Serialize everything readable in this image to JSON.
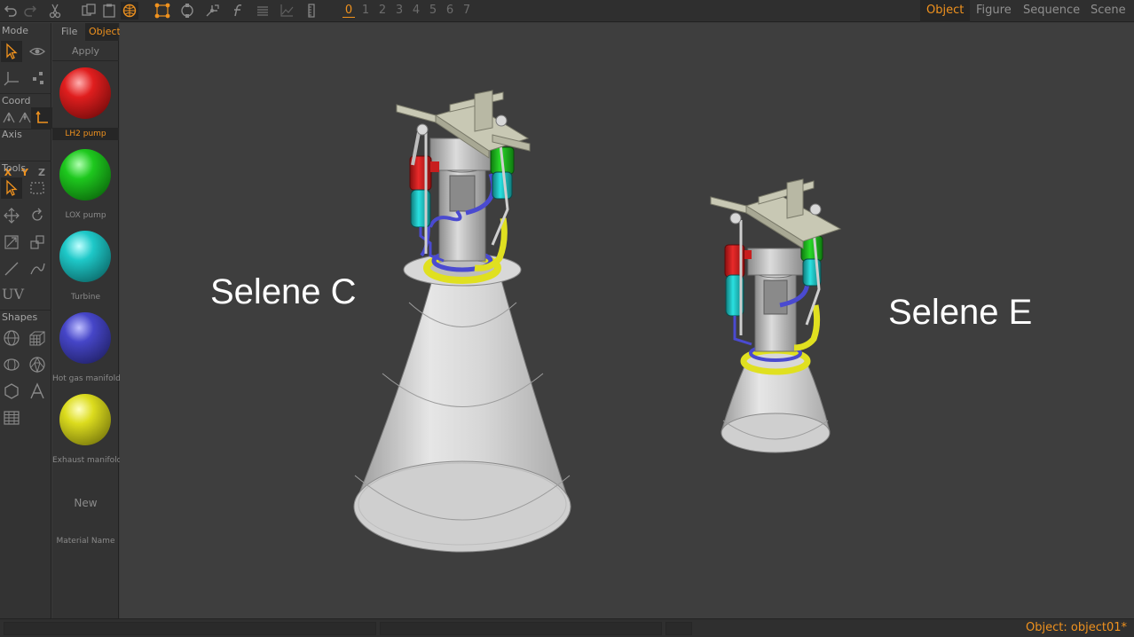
{
  "toolbar": {
    "icons": [
      "undo-icon",
      "redo-icon",
      "cut-icon",
      "copy-icon",
      "paste-icon",
      "select-mode-icon",
      "vertex-icon",
      "rotate-view-icon",
      "transform-icon",
      "function-icon",
      "list-icon",
      "graph-icon",
      "ruler-icon"
    ],
    "layers": [
      "0",
      "1",
      "2",
      "3",
      "4",
      "5",
      "6",
      "7"
    ],
    "active_layer": "0",
    "mode_tabs": [
      "Object",
      "Figure",
      "Sequence",
      "Scene"
    ],
    "active_mode": "Object"
  },
  "left_panel": {
    "mode_label": "Mode",
    "coord_label": "Coord",
    "axis_label": "Axis",
    "axis_x": "X",
    "axis_y": "Y",
    "axis_z": "Z",
    "tools_label": "Tools",
    "uv_label": "UV",
    "shapes_label": "Shapes",
    "accent_color": "#f0921e"
  },
  "material_panel": {
    "tabs": [
      "File",
      "Object"
    ],
    "active_tab": "Object",
    "apply_label": "Apply",
    "materials": [
      {
        "name": "LH2 pump",
        "color": "#e01e1e",
        "selected": true
      },
      {
        "name": "LOX pump",
        "color": "#1ec81e",
        "selected": false
      },
      {
        "name": "Turbine",
        "color": "#1ec8c8",
        "selected": false
      },
      {
        "name": "Hot gas manifold",
        "color": "#4646c8",
        "selected": false
      },
      {
        "name": "Exhaust manifold",
        "color": "#dcdc1e",
        "selected": false
      }
    ],
    "new_label": "New",
    "material_name_label": "Material Name"
  },
  "viewport": {
    "labels": [
      "Selene C",
      "Selene E"
    ],
    "engine_colors": {
      "nozzle": "#d9d9d9",
      "frame": "#c8c8b4",
      "lh2": "#e01e1e",
      "lox": "#1ec81e",
      "turbine": "#1ec8c8",
      "hot_gas": "#4646c8",
      "exhaust": "#dcdc1e"
    }
  },
  "status": {
    "object_text": "Object: object01*"
  }
}
